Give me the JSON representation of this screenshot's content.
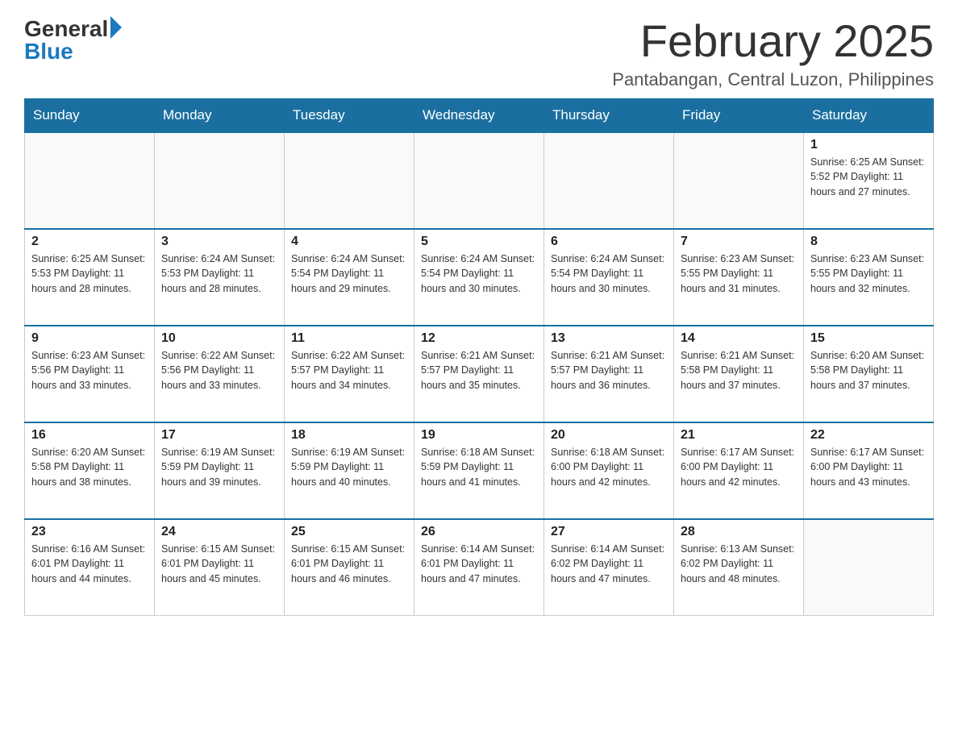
{
  "logo": {
    "general": "General",
    "blue": "Blue"
  },
  "title": "February 2025",
  "location": "Pantabangan, Central Luzon, Philippines",
  "days_of_week": [
    "Sunday",
    "Monday",
    "Tuesday",
    "Wednesday",
    "Thursday",
    "Friday",
    "Saturday"
  ],
  "weeks": [
    [
      {
        "day": "",
        "info": ""
      },
      {
        "day": "",
        "info": ""
      },
      {
        "day": "",
        "info": ""
      },
      {
        "day": "",
        "info": ""
      },
      {
        "day": "",
        "info": ""
      },
      {
        "day": "",
        "info": ""
      },
      {
        "day": "1",
        "info": "Sunrise: 6:25 AM\nSunset: 5:52 PM\nDaylight: 11 hours and 27 minutes."
      }
    ],
    [
      {
        "day": "2",
        "info": "Sunrise: 6:25 AM\nSunset: 5:53 PM\nDaylight: 11 hours and 28 minutes."
      },
      {
        "day": "3",
        "info": "Sunrise: 6:24 AM\nSunset: 5:53 PM\nDaylight: 11 hours and 28 minutes."
      },
      {
        "day": "4",
        "info": "Sunrise: 6:24 AM\nSunset: 5:54 PM\nDaylight: 11 hours and 29 minutes."
      },
      {
        "day": "5",
        "info": "Sunrise: 6:24 AM\nSunset: 5:54 PM\nDaylight: 11 hours and 30 minutes."
      },
      {
        "day": "6",
        "info": "Sunrise: 6:24 AM\nSunset: 5:54 PM\nDaylight: 11 hours and 30 minutes."
      },
      {
        "day": "7",
        "info": "Sunrise: 6:23 AM\nSunset: 5:55 PM\nDaylight: 11 hours and 31 minutes."
      },
      {
        "day": "8",
        "info": "Sunrise: 6:23 AM\nSunset: 5:55 PM\nDaylight: 11 hours and 32 minutes."
      }
    ],
    [
      {
        "day": "9",
        "info": "Sunrise: 6:23 AM\nSunset: 5:56 PM\nDaylight: 11 hours and 33 minutes."
      },
      {
        "day": "10",
        "info": "Sunrise: 6:22 AM\nSunset: 5:56 PM\nDaylight: 11 hours and 33 minutes."
      },
      {
        "day": "11",
        "info": "Sunrise: 6:22 AM\nSunset: 5:57 PM\nDaylight: 11 hours and 34 minutes."
      },
      {
        "day": "12",
        "info": "Sunrise: 6:21 AM\nSunset: 5:57 PM\nDaylight: 11 hours and 35 minutes."
      },
      {
        "day": "13",
        "info": "Sunrise: 6:21 AM\nSunset: 5:57 PM\nDaylight: 11 hours and 36 minutes."
      },
      {
        "day": "14",
        "info": "Sunrise: 6:21 AM\nSunset: 5:58 PM\nDaylight: 11 hours and 37 minutes."
      },
      {
        "day": "15",
        "info": "Sunrise: 6:20 AM\nSunset: 5:58 PM\nDaylight: 11 hours and 37 minutes."
      }
    ],
    [
      {
        "day": "16",
        "info": "Sunrise: 6:20 AM\nSunset: 5:58 PM\nDaylight: 11 hours and 38 minutes."
      },
      {
        "day": "17",
        "info": "Sunrise: 6:19 AM\nSunset: 5:59 PM\nDaylight: 11 hours and 39 minutes."
      },
      {
        "day": "18",
        "info": "Sunrise: 6:19 AM\nSunset: 5:59 PM\nDaylight: 11 hours and 40 minutes."
      },
      {
        "day": "19",
        "info": "Sunrise: 6:18 AM\nSunset: 5:59 PM\nDaylight: 11 hours and 41 minutes."
      },
      {
        "day": "20",
        "info": "Sunrise: 6:18 AM\nSunset: 6:00 PM\nDaylight: 11 hours and 42 minutes."
      },
      {
        "day": "21",
        "info": "Sunrise: 6:17 AM\nSunset: 6:00 PM\nDaylight: 11 hours and 42 minutes."
      },
      {
        "day": "22",
        "info": "Sunrise: 6:17 AM\nSunset: 6:00 PM\nDaylight: 11 hours and 43 minutes."
      }
    ],
    [
      {
        "day": "23",
        "info": "Sunrise: 6:16 AM\nSunset: 6:01 PM\nDaylight: 11 hours and 44 minutes."
      },
      {
        "day": "24",
        "info": "Sunrise: 6:15 AM\nSunset: 6:01 PM\nDaylight: 11 hours and 45 minutes."
      },
      {
        "day": "25",
        "info": "Sunrise: 6:15 AM\nSunset: 6:01 PM\nDaylight: 11 hours and 46 minutes."
      },
      {
        "day": "26",
        "info": "Sunrise: 6:14 AM\nSunset: 6:01 PM\nDaylight: 11 hours and 47 minutes."
      },
      {
        "day": "27",
        "info": "Sunrise: 6:14 AM\nSunset: 6:02 PM\nDaylight: 11 hours and 47 minutes."
      },
      {
        "day": "28",
        "info": "Sunrise: 6:13 AM\nSunset: 6:02 PM\nDaylight: 11 hours and 48 minutes."
      },
      {
        "day": "",
        "info": ""
      }
    ]
  ]
}
